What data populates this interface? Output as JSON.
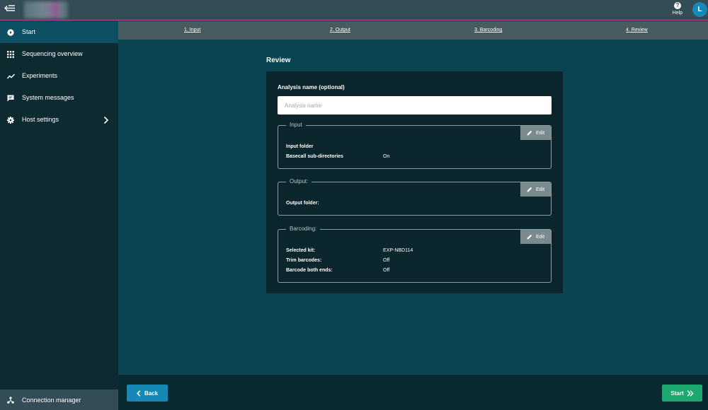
{
  "topbar": {
    "help_label": "Help",
    "avatar_initial": "L"
  },
  "sidebar": {
    "items": [
      {
        "label": "Start",
        "icon": "play-circle-icon",
        "active": true
      },
      {
        "label": "Sequencing overview",
        "icon": "grid-icon"
      },
      {
        "label": "Experiments",
        "icon": "trend-line-icon"
      },
      {
        "label": "System messages",
        "icon": "message-icon"
      },
      {
        "label": "Host settings",
        "icon": "gear-icon"
      }
    ],
    "connection_manager": "Connection manager"
  },
  "steps": [
    "1. Input",
    "2. Output",
    "3. Barcoding",
    "4. Review"
  ],
  "review": {
    "title": "Review",
    "analysis_name_label": "Analysis name (optional)",
    "analysis_name_placeholder": "Analysis name",
    "analysis_name_value": "",
    "edit_label": "Edit",
    "input_section": {
      "legend": "Input",
      "rows": [
        {
          "label": "Input folder",
          "value": ""
        },
        {
          "label": "Basecall sub-directories",
          "value": "On"
        }
      ]
    },
    "output_section": {
      "legend": "Output:",
      "rows": [
        {
          "label": "Output folder:",
          "value": ""
        }
      ]
    },
    "barcoding_section": {
      "legend": "Barcoding:",
      "rows": [
        {
          "label": "Selected kit:",
          "value": "EXP-NBD114"
        },
        {
          "label": "Trim barcodes:",
          "value": "Off"
        },
        {
          "label": "Barcode both ends:",
          "value": "Off"
        }
      ]
    }
  },
  "buttons": {
    "back": "Back",
    "start": "Start"
  },
  "colors": {
    "accent_blue": "#1688b6",
    "start_green": "#1ca86f",
    "active_nav": "#0e5063",
    "main_bg": "#0b4451"
  }
}
